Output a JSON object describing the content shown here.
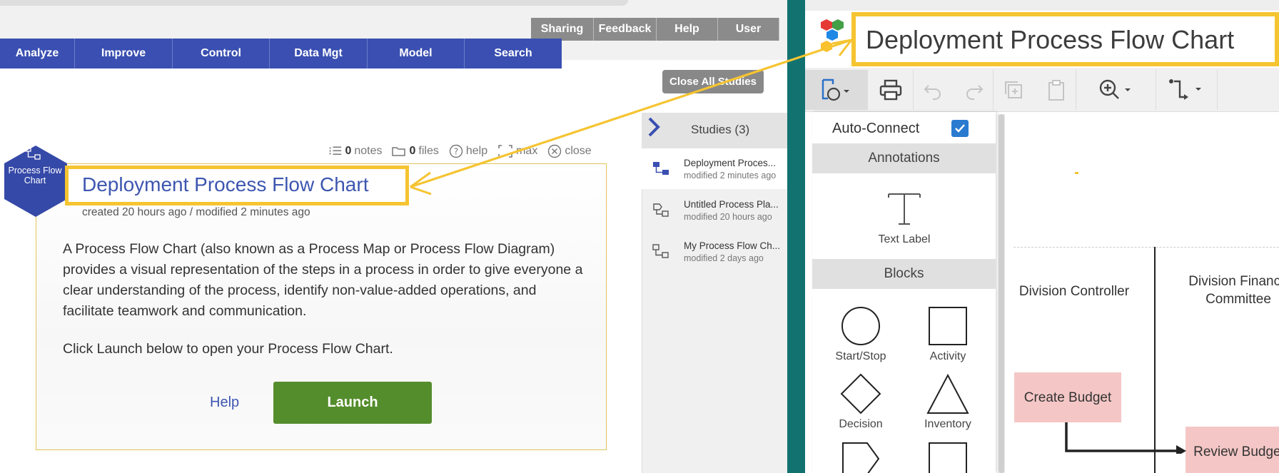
{
  "left_app": {
    "top_buttons": [
      "Sharing",
      "Feedback",
      "Help",
      "User"
    ],
    "nav": [
      "Analyze",
      "Improve",
      "Control",
      "Data Mgt",
      "Model",
      "Search"
    ],
    "close_all_label": "Close All Studies",
    "study": {
      "header_links": {
        "notes_count": "0",
        "notes_label": "notes",
        "files_count": "0",
        "files_label": "files",
        "help_label": "help",
        "max_label": "max",
        "close_label": "close"
      },
      "badge_label": "Process Flow Chart",
      "title": "Deployment Process Flow Chart",
      "meta": "created 20 hours ago / modified 2 minutes ago",
      "description": "A Process Flow Chart (also known as a Process Map or Process Flow Diagram) provides a visual representation of the steps in a process in order to give everyone a clear understanding of the process, identify non-value-added operations, and facilitate teamwork and communication.",
      "prompt": "Click Launch below to open your Process Flow Chart.",
      "help_label": "Help",
      "launch_label": "Launch"
    },
    "studies_panel": {
      "title": "Studies (3)",
      "items": [
        {
          "name": "Deployment Proces...",
          "modified": "modified 2 minutes ago"
        },
        {
          "name": "Untitled Process Pla...",
          "modified": "modified 20 hours ago"
        },
        {
          "name": "My Process Flow Ch...",
          "modified": "modified 2 days ago"
        }
      ]
    }
  },
  "right_app": {
    "title": "Deployment Process Flow Chart",
    "palette": {
      "autoconnect_label": "Auto-Connect",
      "autoconnect_checked": true,
      "sections": [
        "Annotations",
        "Blocks"
      ],
      "annotations": [
        "Text Label"
      ],
      "blocks": [
        "Start/Stop",
        "Activity",
        "Decision",
        "Inventory"
      ]
    },
    "canvas": {
      "lanes": [
        "Division Controller",
        "Division Finance Committee"
      ],
      "boxes": [
        "Create Budget",
        "Review Budget"
      ]
    }
  },
  "colors": {
    "highlight": "#f5c431",
    "nav_blue": "#3a4fb1",
    "launch_green": "#548d2c",
    "divider_teal": "#117270",
    "flow_box_pink": "#f4c7c6"
  }
}
